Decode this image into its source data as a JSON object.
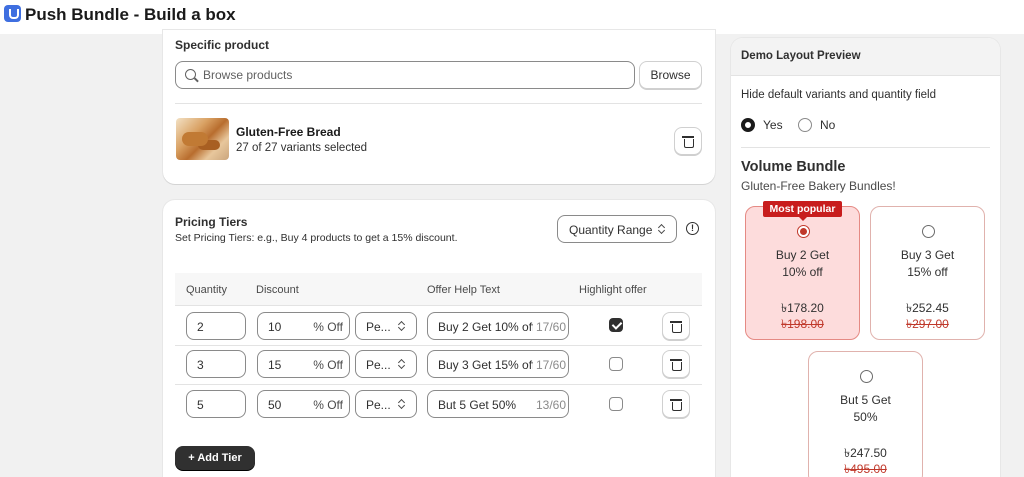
{
  "app": {
    "title": "Push Bundle - Build a box"
  },
  "specific_product": {
    "title": "Specific product",
    "search_placeholder": "Browse products",
    "browse_label": "Browse",
    "product": {
      "name": "Gluten-Free Bread",
      "variants": "27 of 27 variants selected"
    }
  },
  "pricing_tiers": {
    "title": "Pricing Tiers",
    "subtitle": "Set Pricing Tiers: e.g., Buy 4 products to get a 15% discount.",
    "range_select": "Quantity Range",
    "info_icon": "!",
    "columns": [
      "Quantity",
      "Discount",
      "Offer Help Text",
      "Highlight offer"
    ],
    "rows": [
      {
        "quantity": "2",
        "discount": "10",
        "suffix": "% Off",
        "type": "Pe...",
        "help_text": "Buy 2 Get 10% off",
        "counter": "17/60",
        "highlight": true
      },
      {
        "quantity": "3",
        "discount": "15",
        "suffix": "% Off",
        "type": "Pe...",
        "help_text": "Buy 3 Get 15% off",
        "counter": "17/60",
        "highlight": false
      },
      {
        "quantity": "5",
        "discount": "50",
        "suffix": "% Off",
        "type": "Pe...",
        "help_text": "But 5 Get 50%",
        "counter": "13/60",
        "highlight": false
      }
    ],
    "add_tier_label": "+ Add Tier"
  },
  "preview": {
    "header": "Demo Layout Preview",
    "hide_label": "Hide default variants and quantity field",
    "yes_label": "Yes",
    "no_label": "No",
    "hide_selected": "Yes",
    "bundle_title": "Volume Bundle",
    "bundle_subtitle": "Gluten-Free Bakery Bundles!",
    "tiers": [
      {
        "line1": "Buy 2 Get",
        "line2": "10% off",
        "price": "৳178.20",
        "old_price": "৳198.00",
        "badge": "Most popular",
        "selected": true
      },
      {
        "line1": "Buy 3 Get",
        "line2": "15% off",
        "price": "৳252.45",
        "old_price": "৳297.00",
        "selected": false
      },
      {
        "line1": "But 5 Get",
        "line2": "50%",
        "price": "৳247.50",
        "old_price": "৳495.00",
        "selected": false
      }
    ]
  }
}
